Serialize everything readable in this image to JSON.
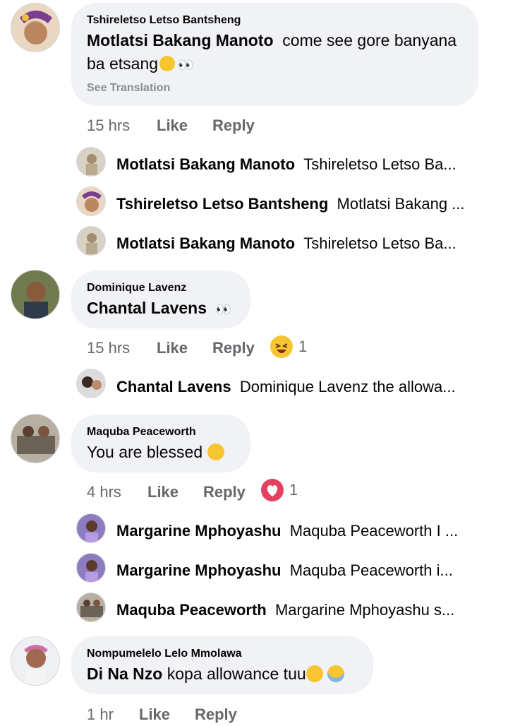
{
  "threads": [
    {
      "author": "Tshireletso Letso Bantsheng",
      "mention": "Motlatsi Bakang Manoto",
      "text_line1": "come see gore banyana",
      "text_line2": "ba etsang",
      "see_translation": "See Translation",
      "time": "15 hrs",
      "like": "Like",
      "reply": "Reply",
      "replies": [
        {
          "name": "Motlatsi Bakang Manoto",
          "snippet": "Tshireletso Letso Ba..."
        },
        {
          "name": "Tshireletso Letso Bantsheng",
          "snippet": "Motlatsi Bakang ..."
        },
        {
          "name": "Motlatsi Bakang Manoto",
          "snippet": "Tshireletso Letso Ba..."
        }
      ]
    },
    {
      "author": "Dominique Lavenz",
      "mention": "Chantal Lavens",
      "time": "15 hrs",
      "like": "Like",
      "reply": "Reply",
      "reaction_count": "1",
      "reaction_icon": "laughing-emoji-icon",
      "replies": [
        {
          "name": "Chantal Lavens",
          "snippet": "Dominique Lavenz the allowa..."
        }
      ]
    },
    {
      "author": "Maquba Peaceworth",
      "text": "You are blessed",
      "time": "4 hrs",
      "like": "Like",
      "reply": "Reply",
      "reaction_count": "1",
      "reaction_icon": "love-heart-icon",
      "replies": [
        {
          "name": "Margarine Mphoyashu",
          "snippet": "Maquba Peaceworth I ..."
        },
        {
          "name": "Margarine Mphoyashu",
          "snippet": "Maquba Peaceworth i..."
        },
        {
          "name": "Maquba Peaceworth",
          "snippet": "Margarine Mphoyashu s..."
        }
      ]
    },
    {
      "author": "Nompumelelo Lelo Mmolawa",
      "mention": "Di Na Nzo",
      "text": "kopa allowance tuu",
      "time": "1 hr",
      "like": "Like",
      "reply": "Reply"
    }
  ],
  "colors": {
    "bubble": "#f0f2f5",
    "meta": "#65676b",
    "heart": "#e4405f",
    "emoji": "#f7c531"
  }
}
